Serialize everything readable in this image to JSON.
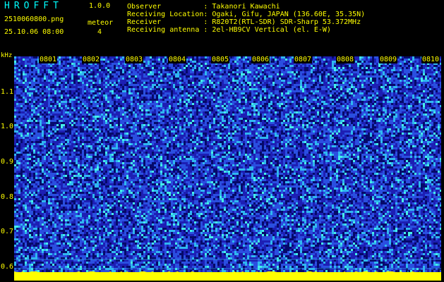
{
  "app": {
    "title": "HROFFT",
    "version": "1.0.0"
  },
  "file": {
    "name": "2510060800.png",
    "datetime": "25.10.06 08:00"
  },
  "meteor": {
    "label": "meteor",
    "count": "4"
  },
  "info": [
    {
      "key": "Observer",
      "sep": ":",
      "value": "Takanori Kawachi"
    },
    {
      "key": "Receiving Location",
      "sep": ":",
      "value": "Ogaki, Gifu, JAPAN (136.60E, 35.35N)"
    },
    {
      "key": "Receiver",
      "sep": ":",
      "value": "R820T2(RTL-SDR) SDR-Sharp 53.372MHz"
    },
    {
      "key": "Receiving antenna",
      "sep": ":",
      "value": "2el-HB9CV Vertical (el. E-W)"
    }
  ],
  "y_axis": {
    "unit": "kHz",
    "ticks": [
      "1.1",
      "1.0",
      "0.9",
      "0.8",
      "0.7",
      "0.6"
    ]
  },
  "x_axis": {
    "ticks": [
      "0801",
      "0802",
      "0803",
      "0804",
      "0805",
      "0806",
      "0807",
      "0808",
      "0809",
      "0810"
    ]
  },
  "colors": {
    "background": "#000000",
    "label": "#ffff00",
    "title": "#00ffff",
    "waterfall_base": "#1d1fb4",
    "noise_dark": "#050a6a",
    "noise_mid": "#2a4fe0",
    "noise_light": "#2fb8f0",
    "noise_cyan": "#45f0e8",
    "baseline": "#ffff00",
    "marker": "#00c8ff"
  }
}
